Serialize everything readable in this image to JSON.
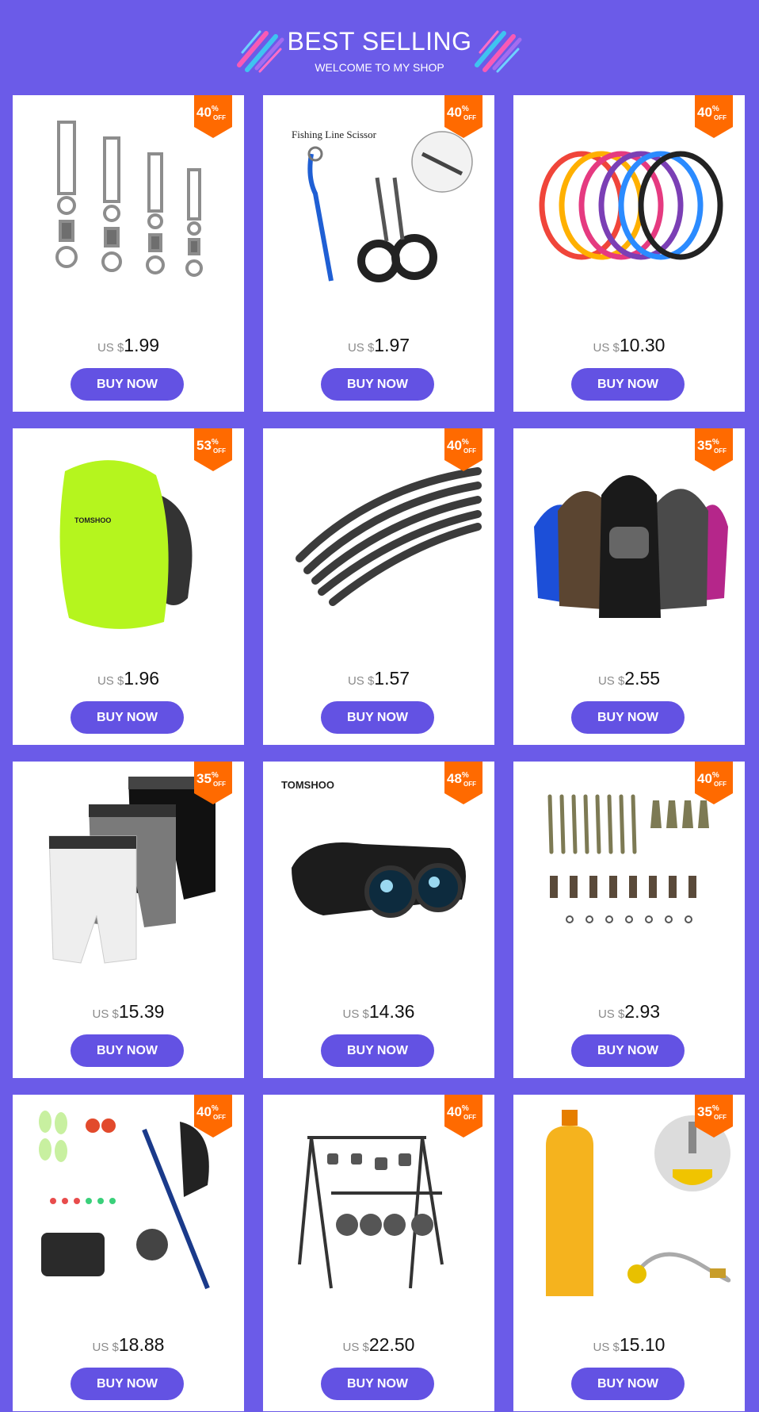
{
  "header": {
    "title": "BEST SELLING",
    "subtitle": "WELCOME TO MY SHOP"
  },
  "colors": {
    "background": "#6B5BE8",
    "button": "#6352E3",
    "badge": "#FF6A00"
  },
  "currency_label": "US $",
  "buy_label": "BUY NOW",
  "off_label": "OFF",
  "products": [
    {
      "discount": "40",
      "price": "1.99",
      "image": "snap-swivels",
      "image_text": ""
    },
    {
      "discount": "40",
      "price": "1.97",
      "image": "fishing-line-scissor",
      "image_text": "Fishing Line Scissor"
    },
    {
      "discount": "40",
      "price": "10.30",
      "image": "colorful-rings",
      "image_text": ""
    },
    {
      "discount": "53",
      "price": "1.96",
      "image": "backpack-rain-cover",
      "image_text": "TOMSHOO"
    },
    {
      "discount": "40",
      "price": "1.57",
      "image": "black-tubes",
      "image_text": ""
    },
    {
      "discount": "35",
      "price": "2.55",
      "image": "balaclavas",
      "image_text": ""
    },
    {
      "discount": "35",
      "price": "15.39",
      "image": "compression-shorts",
      "image_text": ""
    },
    {
      "discount": "48",
      "price": "14.36",
      "image": "binoculars",
      "image_text": "TOMSHOO"
    },
    {
      "discount": "40",
      "price": "2.93",
      "image": "carp-rig-kit",
      "image_text": ""
    },
    {
      "discount": "40",
      "price": "18.88",
      "image": "fishing-rod-kit",
      "image_text": ""
    },
    {
      "discount": "40",
      "price": "22.50",
      "image": "camping-hanging-rack",
      "image_text": ""
    },
    {
      "discount": "35",
      "price": "15.10",
      "image": "gas-refill-adapter",
      "image_text": ""
    }
  ]
}
